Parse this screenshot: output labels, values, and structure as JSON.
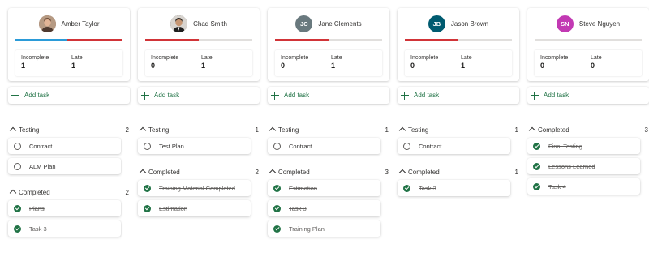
{
  "columns": [
    {
      "name": "Amber Taylor",
      "avatar": {
        "type": "photo",
        "icon": "amber-photo-icon",
        "initials": "",
        "color": "#8a6a55"
      },
      "progress": [
        {
          "color": "#2b9bd8",
          "fraction": 0.48
        },
        {
          "color": "#d13438",
          "fraction": 0.52
        }
      ],
      "stats": {
        "incomplete_label": "Incomplete",
        "incomplete": "1",
        "late_label": "Late",
        "late": "1"
      },
      "add_task": "Add task",
      "groups": [
        {
          "name": "Testing",
          "count": "2",
          "tasks": [
            {
              "name": "Contract",
              "completed": false
            },
            {
              "name": "ALM Plan",
              "completed": false
            }
          ]
        },
        {
          "name": "Completed",
          "count": "2",
          "tasks": [
            {
              "name": "Plans",
              "completed": true
            },
            {
              "name": "Task 3",
              "completed": true
            }
          ]
        }
      ]
    },
    {
      "name": "Chad Smith",
      "avatar": {
        "type": "photo",
        "icon": "chad-photo-icon",
        "initials": "",
        "color": "#3b3b3b"
      },
      "progress": [
        {
          "color": "#d13438",
          "fraction": 0.5
        }
      ],
      "stats": {
        "incomplete_label": "Incomplete",
        "incomplete": "0",
        "late_label": "Late",
        "late": "1"
      },
      "add_task": "Add task",
      "groups": [
        {
          "name": "Testing",
          "count": "1",
          "tasks": [
            {
              "name": "Test Plan",
              "completed": false
            }
          ]
        },
        {
          "name": "Completed",
          "count": "2",
          "tasks": [
            {
              "name": "Training Material Completed",
              "completed": true
            },
            {
              "name": "Estimation",
              "completed": true
            }
          ]
        }
      ]
    },
    {
      "name": "Jane Clements",
      "avatar": {
        "type": "initials",
        "icon": "",
        "initials": "JC",
        "color": "#69797e"
      },
      "progress": [
        {
          "color": "#d13438",
          "fraction": 0.5
        }
      ],
      "stats": {
        "incomplete_label": "Incomplete",
        "incomplete": "0",
        "late_label": "Late",
        "late": "1"
      },
      "add_task": "Add task",
      "groups": [
        {
          "name": "Testing",
          "count": "1",
          "tasks": [
            {
              "name": "Contract",
              "completed": false
            }
          ]
        },
        {
          "name": "Completed",
          "count": "3",
          "tasks": [
            {
              "name": "Estimation",
              "completed": true
            },
            {
              "name": "Task 3",
              "completed": true
            },
            {
              "name": "Training Plan",
              "completed": true
            }
          ]
        }
      ]
    },
    {
      "name": "Jason Brown",
      "avatar": {
        "type": "initials",
        "icon": "",
        "initials": "JB",
        "color": "#005b70"
      },
      "progress": [
        {
          "color": "#d13438",
          "fraction": 0.5
        }
      ],
      "stats": {
        "incomplete_label": "Incomplete",
        "incomplete": "0",
        "late_label": "Late",
        "late": "1"
      },
      "add_task": "Add task",
      "groups": [
        {
          "name": "Testing",
          "count": "1",
          "tasks": [
            {
              "name": "Contract",
              "completed": false
            }
          ]
        },
        {
          "name": "Completed",
          "count": "1",
          "tasks": [
            {
              "name": "Task 3",
              "completed": true
            }
          ]
        }
      ]
    },
    {
      "name": "Steve Nguyen",
      "avatar": {
        "type": "initials",
        "icon": "",
        "initials": "SN",
        "color": "#c239b3"
      },
      "progress": [],
      "stats": {
        "incomplete_label": "Incomplete",
        "incomplete": "0",
        "late_label": "Late",
        "late": "0"
      },
      "add_task": "Add task",
      "groups": [
        {
          "name": "Completed",
          "count": "3",
          "tasks": [
            {
              "name": "Final Testing",
              "completed": true
            },
            {
              "name": "Lessons Learned",
              "completed": true
            },
            {
              "name": "Task 4",
              "completed": true
            }
          ]
        }
      ]
    }
  ]
}
